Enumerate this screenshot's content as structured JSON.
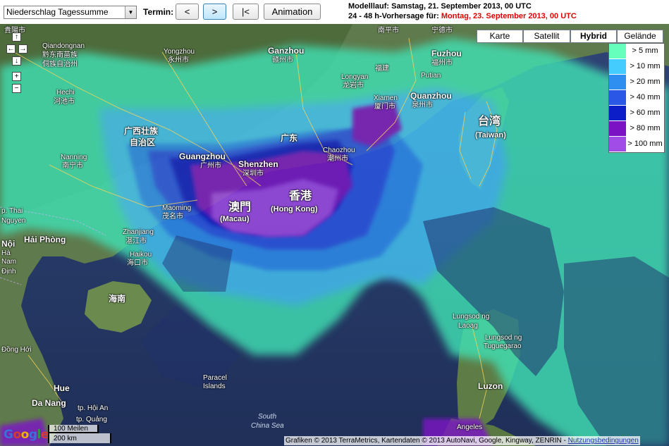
{
  "toolbar": {
    "parameter": "Niederschlag Tagessumme",
    "termin_label": "Termin:",
    "prev_button": "<",
    "next_button": ">",
    "first_button": "|<",
    "animation_button": "Animation"
  },
  "info": {
    "model_run": "Modelllauf: Samstag, 21. September 2013, 00 UTC",
    "forecast_prefix": "24 - 48 h-Vorhersage für:",
    "forecast_date": "Montag, 23. September 2013, 00 UTC"
  },
  "map_types": [
    "Karte",
    "Satellit",
    "Hybrid",
    "Gelände"
  ],
  "active_map_type": "Hybrid",
  "legend": [
    {
      "label": "> 5 mm",
      "color": "#66ffbb"
    },
    {
      "label": "> 10 mm",
      "color": "#44ccff"
    },
    {
      "label": "> 20 mm",
      "color": "#2e8ff0"
    },
    {
      "label": "> 40 mm",
      "color": "#2a57e6"
    },
    {
      "label": "> 60 mm",
      "color": "#0c1ec8"
    },
    {
      "label": "> 80 mm",
      "color": "#7b12c4"
    },
    {
      "label": "> 100 mm",
      "color": "#a24ce8"
    }
  ],
  "nav": {
    "up": "↑",
    "left": "←",
    "right": "→",
    "down": "↓",
    "zoom_in": "+",
    "zoom_out": "−"
  },
  "places": {
    "a1": "貴陽市",
    "a2": "Qiandongnan",
    "a3": "黔东南苗族",
    "a4": "侗族自治州",
    "a5": "Hechi",
    "a6": "河池市",
    "a7": "Yongzhou",
    "a8": "永州市",
    "a9": "Ganzhou",
    "a10": "赣州市",
    "a11": "Longyan",
    "a12": "龙岩市",
    "a13": "福建",
    "a14": "Xiamen",
    "a15": "厦门市",
    "a16": "Quanzhou",
    "a17": "泉州市",
    "a18": "Putian",
    "a19": "Fuzhou",
    "a20": "福州市",
    "a21": "南平市",
    "a22": "宁德市",
    "a23": "广西壮族",
    "a24": "自治区",
    "a25": "Nanning",
    "a26": "南宁市",
    "a27": "Guangzhou",
    "a28": "广州市",
    "a29": "Shenzhen",
    "a30": "深圳市",
    "a31": "Chaozhou",
    "a32": "潮州市",
    "a33": "广东",
    "a34": "台湾",
    "a35": "(Taiwan)",
    "a36": "澳門",
    "a37": "(Macau)",
    "a38": "香港",
    "a39": "(Hong Kong)",
    "a40": "Maoming",
    "a41": "茂名市",
    "a42": "Zhanjiang",
    "a43": "湛江市",
    "a44": "Haikou",
    "a45": "海口市",
    "a46": "海南",
    "a47": "Hải Phòng",
    "a48": "p. Thai",
    "a49": "Nguyen",
    "a50": "Nội",
    "a51": "Nam",
    "a52": "Định",
    "a53": "Đồng Hới",
    "a54": "Hue",
    "a55": "Da Nang",
    "a56": "tp. Hội An",
    "a57": "tp. Quảng",
    "a58": "Paracel",
    "a59": "Islands",
    "a60": "South",
    "a61": "China Sea",
    "a62": "Lungsod ng",
    "a63": "Laoag",
    "a64": "Lungsod ng",
    "a65": "Tuguegarao",
    "a66": "Luzon",
    "a67": "Angeles",
    "a68": "Hà"
  },
  "attribution_text": "Grafiken © 2013 TerraMetrics, Kartendaten © 2013 AutoNavi, Google, Kingway, ZENRIN -",
  "attribution_link": "Nutzungsbedingungen",
  "scale": {
    "miles": "100 Meilen",
    "km": "200 km"
  },
  "logo": {
    "g1": "G",
    "o1": "o",
    "o2": "o",
    "g2": "g",
    "l": "l",
    "e": "e"
  }
}
